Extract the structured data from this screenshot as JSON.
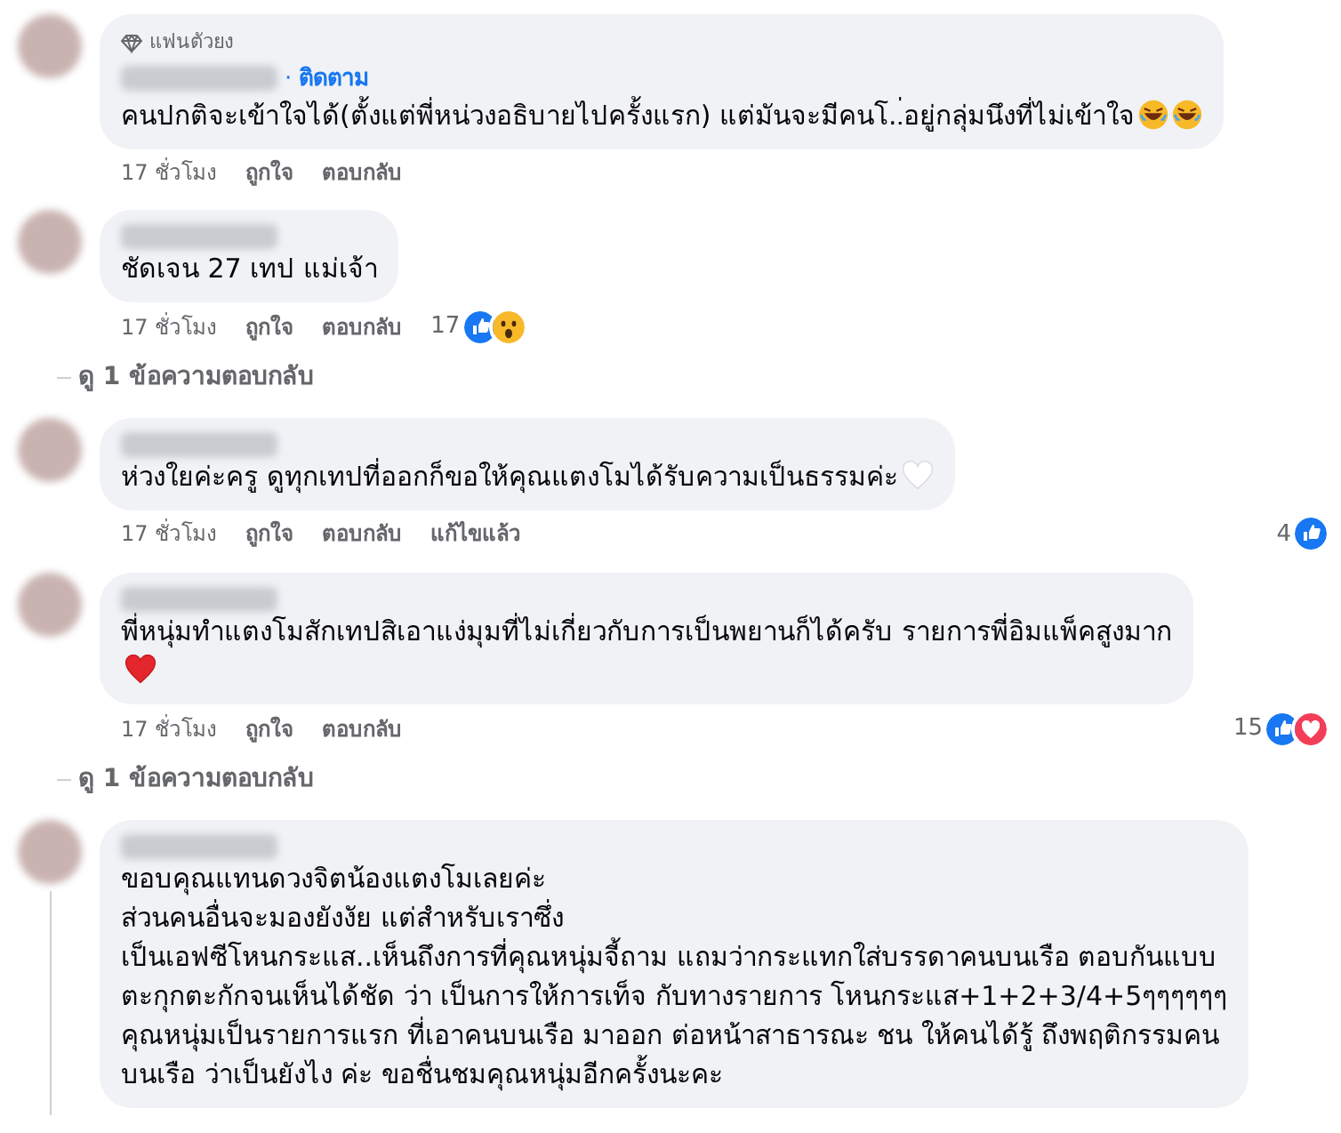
{
  "comments": [
    {
      "badge": "แฟนตัวยง",
      "separator": "·",
      "follow": "ติดตาม",
      "text": "คนปกติจะเข้าใจได้(ตั้งแต่พี่หน่วงอธิบายไปครั้งแรก) แต่มันจะมีคนโ..่อยู่กลุ่มนึงที่ไม่เข้าใจ",
      "emojis": [
        {
          "kind": "laugh"
        },
        {
          "kind": "laugh"
        }
      ],
      "emoji_on_new_line": false,
      "actions": [
        "17 ชั่วโมง",
        "ถูกใจ",
        "ตอบกลับ"
      ]
    },
    {
      "text": "ชัดเจน 27 เทป แม่เจ้า",
      "actions": [
        "17 ชั่วโมง",
        "ถูกใจ",
        "ตอบกลับ"
      ],
      "reactions": {
        "count": "17",
        "items": [
          {
            "kind": "like"
          },
          {
            "kind": "wow"
          }
        ]
      },
      "replies_link": "ดู 1 ข้อความตอบกลับ"
    },
    {
      "text": "ห่วงใยค่ะครู ดูทุกเทปที่ออกก็ขอให้คุณแตงโมได้รับความเป็นธรรมค่ะ",
      "emojis": [
        {
          "kind": "whiteheart"
        }
      ],
      "emoji_on_new_line": false,
      "actions": [
        "17 ชั่วโมง",
        "ถูกใจ",
        "ตอบกลับ",
        "แก้ไขแล้ว"
      ],
      "reactions": {
        "count": "4",
        "items": [
          {
            "kind": "like"
          }
        ]
      }
    },
    {
      "text": "พี่หนุ่มทำแตงโมสักเทปสิเอาแง่มุมที่ไม่เกี่ยวกับการเป็นพยานก็ได้ครับ รายการพี่อิมแพ็คสูงมาก",
      "emojis": [
        {
          "kind": "redheart"
        }
      ],
      "emoji_on_new_line": true,
      "actions": [
        "17 ชั่วโมง",
        "ถูกใจ",
        "ตอบกลับ"
      ],
      "reactions": {
        "count": "15",
        "items": [
          {
            "kind": "like"
          },
          {
            "kind": "love"
          }
        ]
      },
      "replies_link": "ดู 1 ข้อความตอบกลับ"
    },
    {
      "text": "ขอบคุณแทนดวงจิตน้องแตงโมเลยค่ะ\nส่วนคนอื่นจะมองยังงัย แต่สำหรับเราซึ่ง\nเป็นเอฟซีโหนกระแส..เห็นถึงการที่คุณหนุ่มจี้ถาม แถมว่ากระแทกใส่บรรดาคนบนเรือ ตอบกันแบบ\nตะกุกตะกักจนเห็นได้ชัด ว่า เป็นการให้การเท็จ กับทางรายการ โหนกระแส+1+2+3/4+5ๆๆๆๆๆๆ\nคุณหนุ่มเป็นรายการแรก ที่เอาคนบนเรือ มาออก ต่อหน้าสาธารณะ ชน ให้คนได้รู้ ถึงพฤติกรรมคน\nบนเรือ ว่าเป็นยังไง ค่ะ ขอชื่นชมคุณหนุ่มอีกครั้งนะคะ",
      "thread_line": true
    }
  ]
}
